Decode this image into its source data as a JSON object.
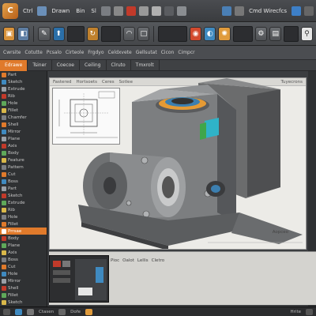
{
  "menubar": {
    "logo": "C",
    "items": [
      "Ctrl",
      "Drawn",
      "Bin",
      "Sl"
    ],
    "right_label": "Cmd Wirecfcs"
  },
  "toolrow2": {
    "items": [
      "Cwrsite",
      "Cotutte",
      "Pcsalo",
      "Cirteole",
      "Frgdyo",
      "Celdxvete",
      "Gellsutat",
      "Cicon",
      "Cimpcr"
    ]
  },
  "tabs": [
    "Edrawe",
    "Tsiner",
    "Coecoe",
    "Ceiling",
    "Clruto",
    "Tmxrolt"
  ],
  "tree": {
    "rows": [
      "Part",
      "Sketch",
      "Extrude",
      "Rib",
      "Hole",
      "Fillet",
      "Chamfer",
      "Shell",
      "Mirror",
      "Plane",
      "Axis",
      "Body",
      "Feature",
      "Pattern",
      "Cut",
      "Boss",
      "Part",
      "Sketch",
      "Extrude",
      "Rib",
      "Hole",
      "Fillet"
    ],
    "highlight": "Prrsae",
    "rows_after": [
      "Body",
      "Plane",
      "Axis",
      "Boss",
      "Cut",
      "Hole",
      "Mirror",
      "Shell",
      "Fillet",
      "Sketch",
      "Extrude",
      "Feature"
    ]
  },
  "viewport": {
    "header_items": [
      "Fastered",
      "Hortsoets",
      "Ceres",
      "Sotlee",
      "Tuyecrons"
    ],
    "footnote": "Aopceo"
  },
  "bottom": {
    "labels": [
      "Pioc",
      "Oalot",
      "Lellis",
      "Cletro"
    ]
  },
  "status": {
    "labels": [
      "Ctasen",
      "Dofe",
      "Hrite"
    ]
  }
}
